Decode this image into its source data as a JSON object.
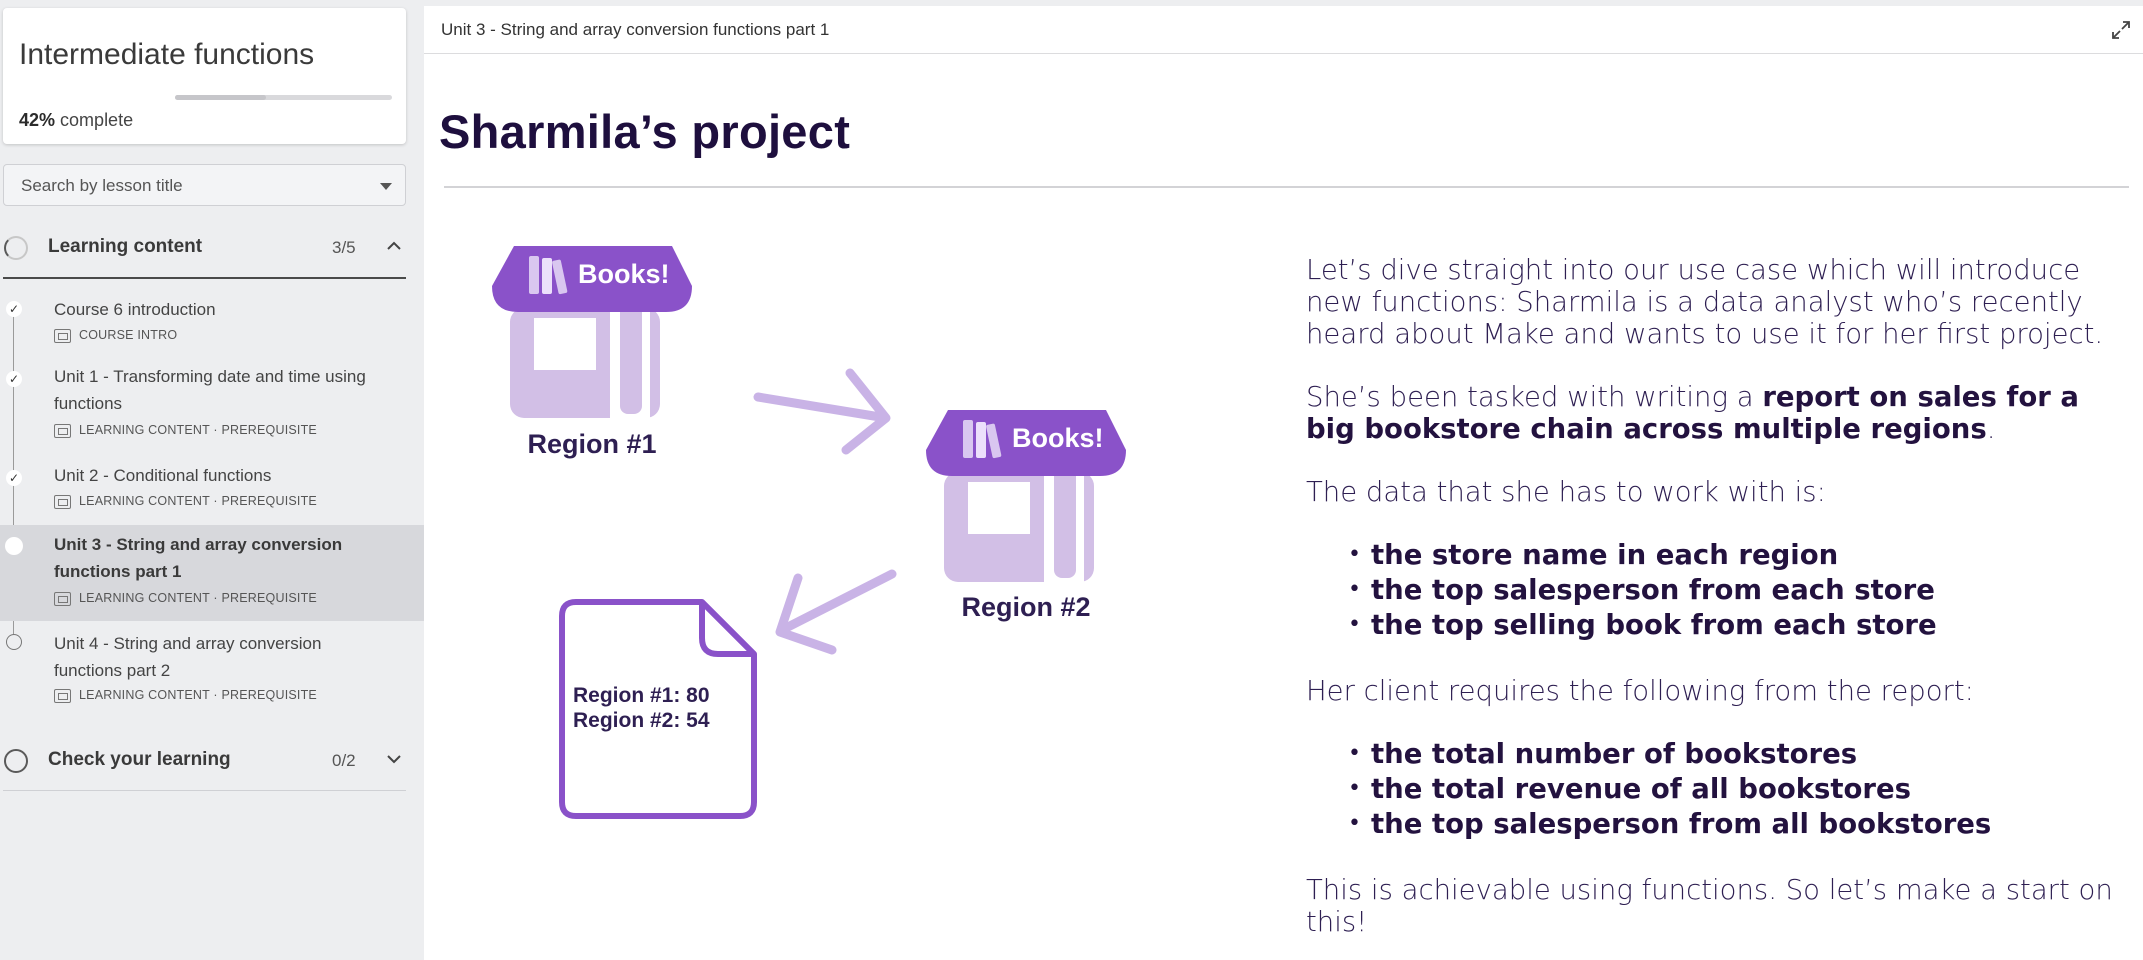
{
  "sidebar": {
    "course_title": "Intermediate functions",
    "progress_percent": "42%",
    "progress_word": "complete",
    "progress_value": 0.42,
    "search_placeholder": "Search by lesson title",
    "sections": [
      {
        "label": "Learning content",
        "count": "3/5",
        "chevron": "up",
        "lessons": [
          {
            "title": "Course 6 introduction",
            "meta": "COURSE INTRO",
            "status": "done"
          },
          {
            "title": "Unit 1 - Transforming date and time using functions",
            "meta": "LEARNING CONTENT · PREREQUISITE",
            "status": "done"
          },
          {
            "title": "Unit 2 - Conditional functions",
            "meta": "LEARNING CONTENT · PREREQUISITE",
            "status": "done"
          },
          {
            "title": "Unit 3 - String and array conversion functions part 1",
            "meta": "LEARNING CONTENT · PREREQUISITE",
            "status": "active"
          },
          {
            "title": "Unit 4 - String and array conversion functions part 2",
            "meta": "LEARNING CONTENT · PREREQUISITE",
            "status": "open"
          }
        ]
      },
      {
        "label": "Check your learning",
        "count": "0/2",
        "chevron": "down"
      }
    ]
  },
  "main": {
    "breadcrumb": "Unit 3 - String and array conversion functions part 1",
    "page_title": "Sharmila’s project",
    "illustration": {
      "store_sign": "Books!",
      "region1_label": "Region #1",
      "region2_label": "Region #2",
      "doc_line1": "Region #1: 80",
      "doc_line2": "Region #2: 54",
      "colors": {
        "primary": "#8a52c9",
        "light": "#d2bfe6",
        "arrow": "#c9b3e6",
        "doc": "#8a52c9"
      }
    },
    "body": {
      "p1": "Let’s dive straight into our use case which will introduce new functions: Sharmila is a data analyst who’s recently heard about Make and wants to use it for her first project.",
      "p2_pre": "She’s been tasked with writing a ",
      "p2_bold": "report on sales for a big bookstore chain across multiple regions",
      "p2_post": ".",
      "p3": "The data that she has to work with is:",
      "list1": [
        "the store name in each region",
        "the top salesperson from each store",
        "the top selling book from each store"
      ],
      "p4": "Her client requires the following from the report:",
      "list2": [
        "the total number of bookstores",
        "the total revenue of all bookstores",
        "the top salesperson from all bookstores"
      ],
      "p5": "This is achievable using functions. So let’s make a start on this!"
    }
  }
}
